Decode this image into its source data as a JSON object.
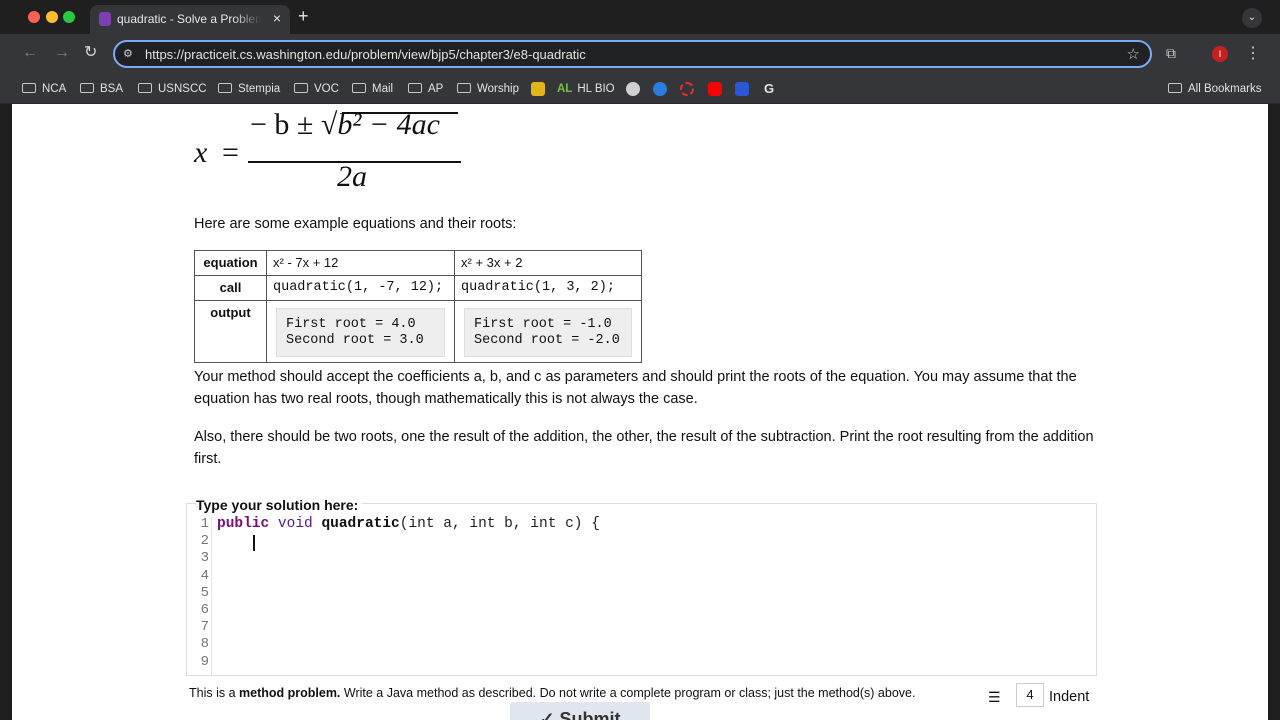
{
  "browser": {
    "tab_title": "quadratic - Solve a Problem - Practice-It",
    "tab_close": "×",
    "new_tab": "+",
    "url": "https://practiceit.cs.washington.edu/problem/view/bjp5/chapter3/e8-quadratic",
    "profile_initial": "I",
    "bookmarks": [
      "NCA",
      "BSA",
      "USNSCC",
      "Stempia",
      "VOC",
      "Mail",
      "AP",
      "Worship"
    ],
    "bookmark_hl": "HL BIO",
    "bookmark_g": "G",
    "all_bookmarks": "All Bookmarks"
  },
  "problem": {
    "formula": {
      "x": "x",
      "eq": "=",
      "numerator_prefix": "− b ± √",
      "numerator_rest": "b² − 4ac",
      "denominator": "2a"
    },
    "intro": "Here are some example equations and their roots:",
    "table": {
      "row_headers": [
        "equation",
        "call",
        "output"
      ],
      "examples": [
        {
          "equation": "x² - 7x + 12",
          "call": "quadratic(1, -7, 12);",
          "output": "First root = 4.0\nSecond root = 3.0"
        },
        {
          "equation": "x² + 3x + 2",
          "call": "quadratic(1, 3, 2);",
          "output": "First root = -1.0\nSecond root = -2.0"
        }
      ]
    },
    "para1": "Your method should accept the coefficients a, b, and c as parameters and should print the roots of the equation. You may assume that the equation has two real roots, though mathematically this is not always the case.",
    "para2": "Also, there should be two roots, one the result of the addition, the other, the result of the subtraction. Print the root resulting from the addition first."
  },
  "editor": {
    "label": "Type your solution here:",
    "line_numbers": [
      "1",
      "2",
      "3",
      "4",
      "5",
      "6",
      "7",
      "8",
      "9"
    ],
    "code": {
      "kw_public": "public",
      "kw_void": "void",
      "fn_name": "quadratic",
      "params": "(int a, int b, int c) {"
    }
  },
  "footer": {
    "hint_prefix": "This is a ",
    "hint_bold": "method problem.",
    "hint_rest": " Write a Java method as described. Do not write a complete program or class; just the method(s) above.",
    "indent_value": "4",
    "indent_label": "Indent",
    "submit_label": "✓ Submit"
  }
}
